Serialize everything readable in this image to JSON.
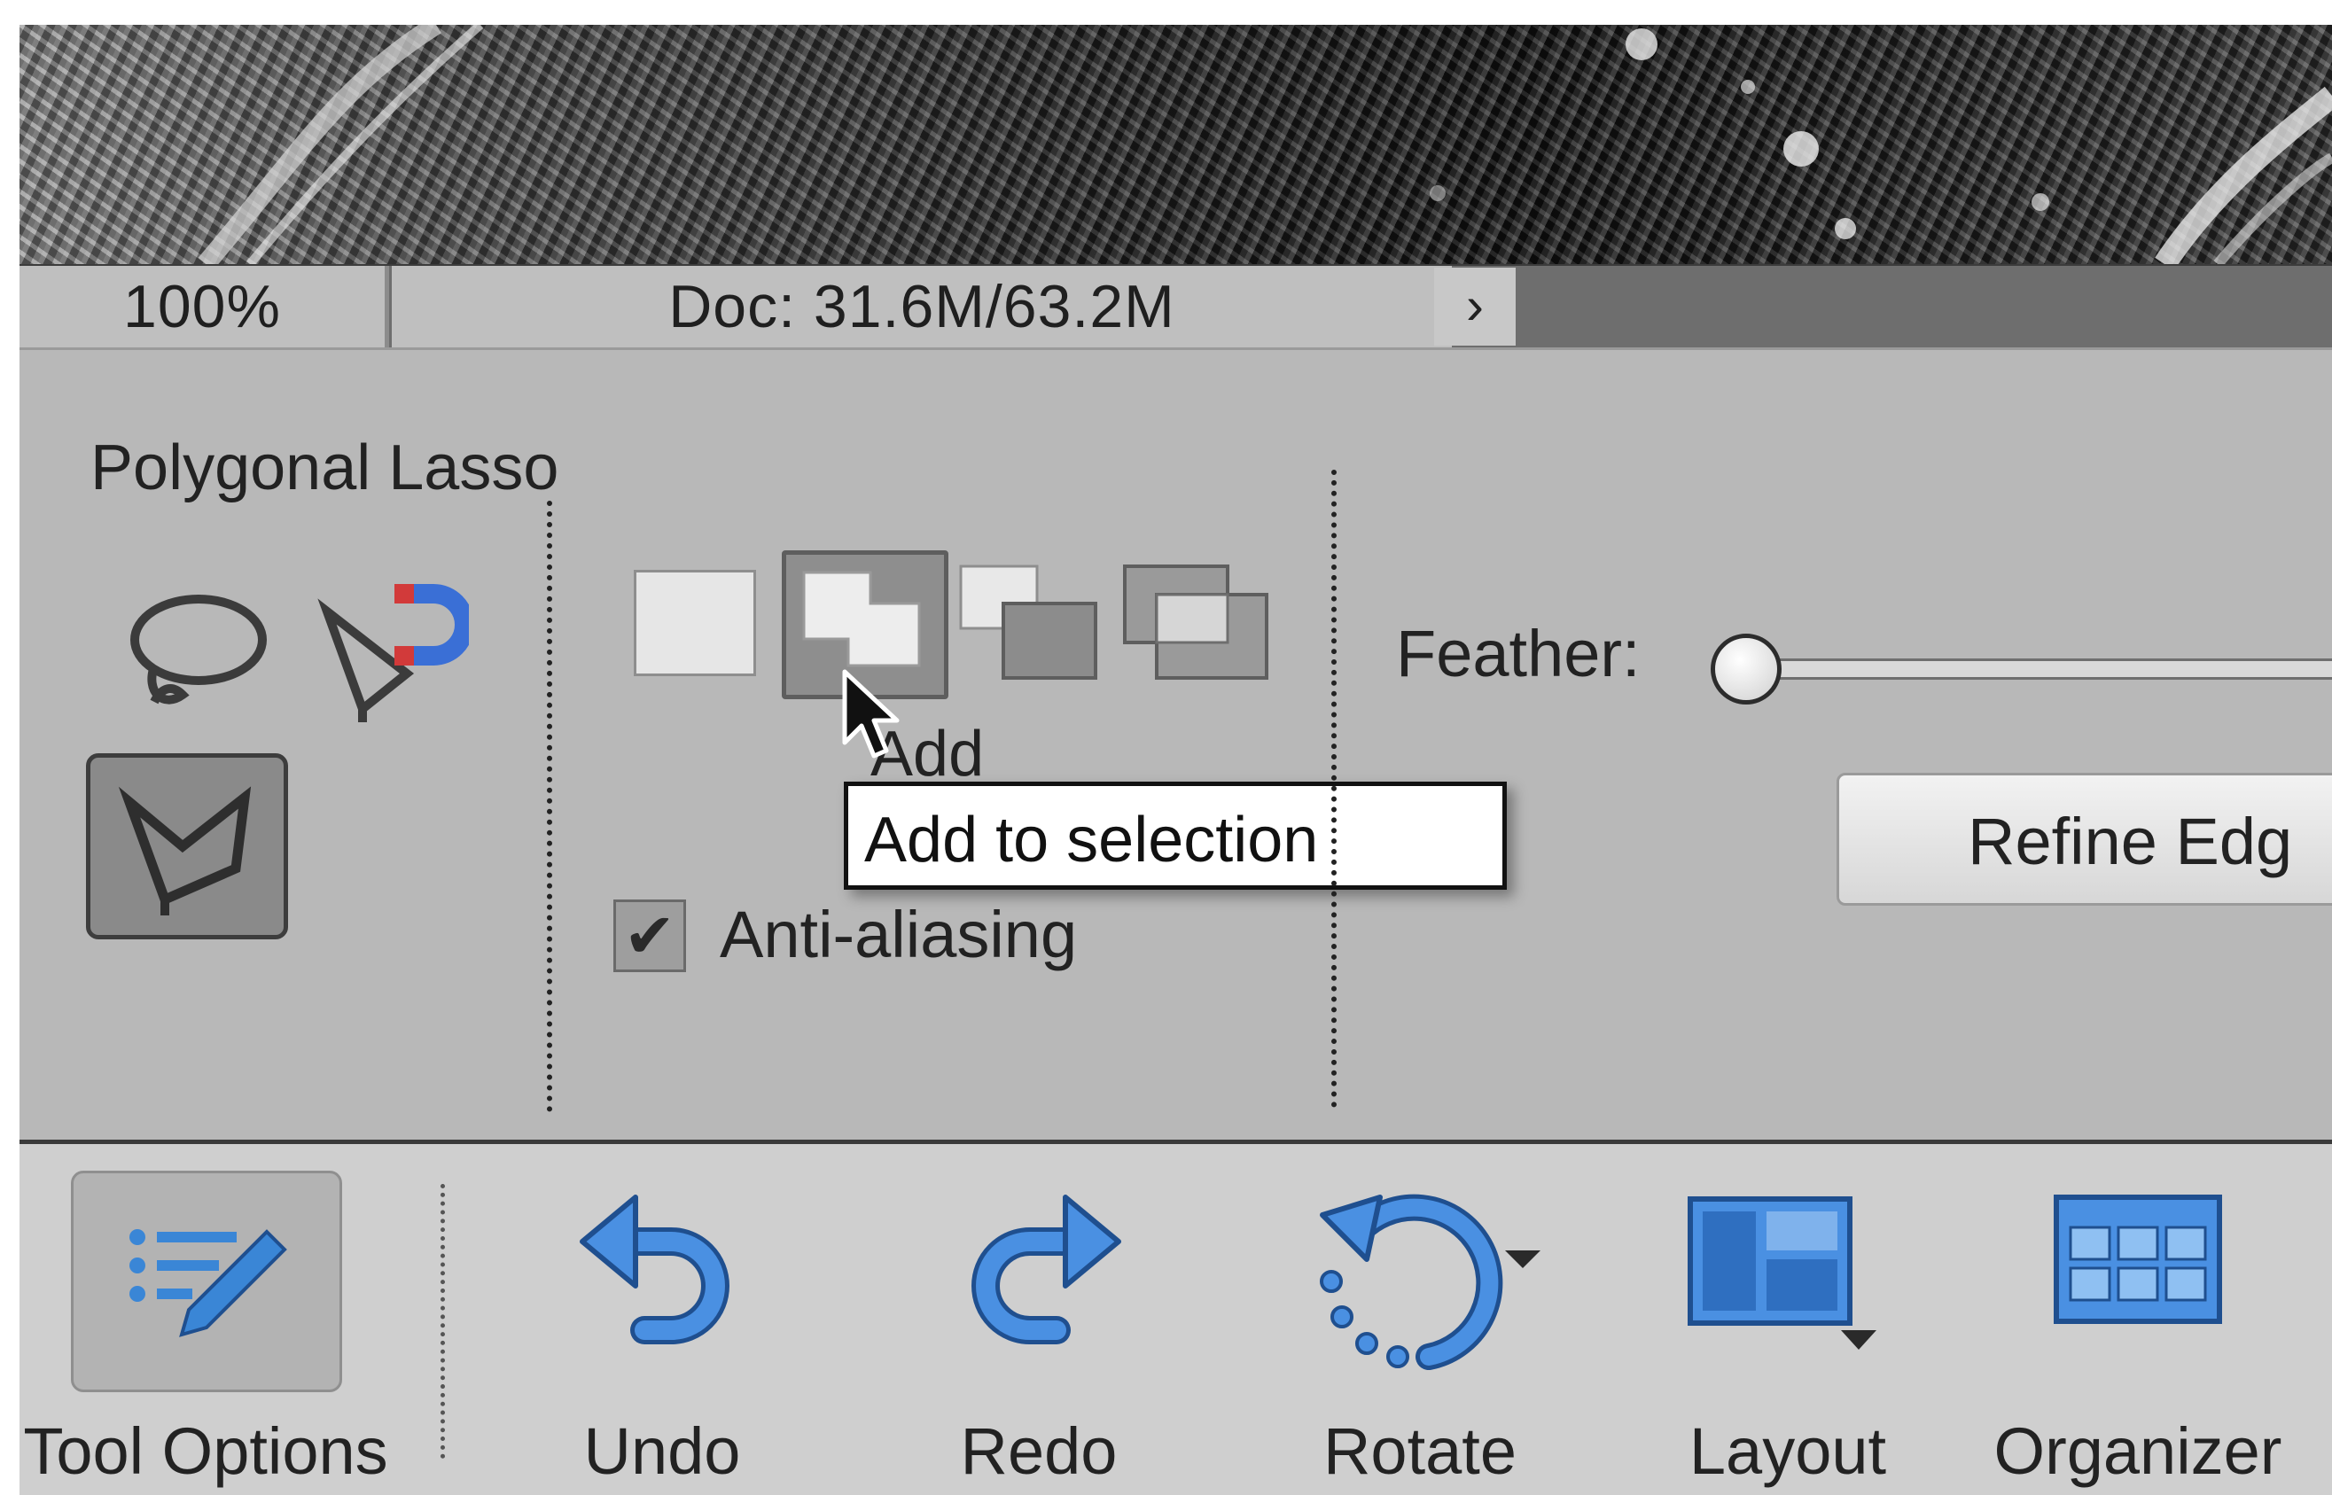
{
  "status_bar": {
    "zoom": "100%",
    "doc_info": "Doc: 31.6M/63.2M",
    "arrow_icon": "chevron-right-icon"
  },
  "tool_options": {
    "tool_title": "Polygonal Lasso",
    "tools": [
      {
        "name": "lasso-tool",
        "icon": "lasso-icon",
        "selected": false
      },
      {
        "name": "magnetic-lasso-tool",
        "icon": "magnetic-lasso-icon",
        "selected": false
      },
      {
        "name": "polygonal-lasso-tool",
        "icon": "polygonal-lasso-icon",
        "selected": true
      }
    ],
    "selection_modes": [
      "new",
      "add",
      "subtract",
      "intersect"
    ],
    "selected_mode": "add",
    "mode_label": "Add",
    "tooltip": "Add to selection",
    "anti_aliasing": {
      "label": "Anti-aliasing",
      "checked": true
    },
    "feather": {
      "label": "Feather:",
      "value_fraction": 0.0
    },
    "refine_edge_label": "Refine Edg"
  },
  "taskbar": {
    "tool_options_label": "Tool Options",
    "undo_label": "Undo",
    "redo_label": "Redo",
    "rotate_label": "Rotate",
    "layout_label": "Layout",
    "organizer_label": "Organizer"
  },
  "colors": {
    "accent_blue": "#3a86d6",
    "panel_gray": "#b8b8b8",
    "taskbar_gray": "#cfcfcf",
    "magnet_red": "#d23a3a"
  }
}
